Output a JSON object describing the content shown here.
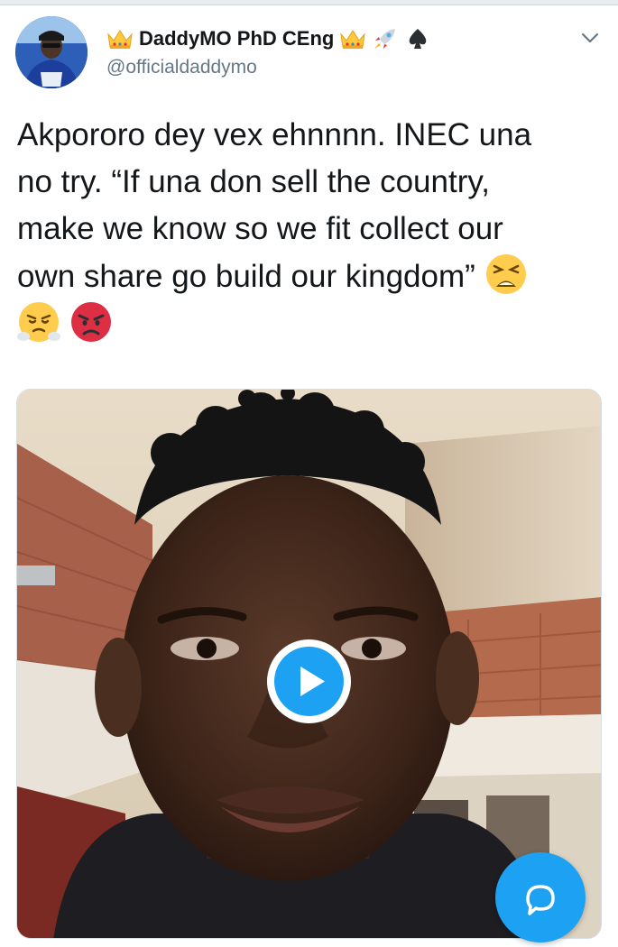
{
  "tweet": {
    "display_name": "DaddyMO PhD CEng",
    "handle": "@officialdaddymo",
    "text_lines": [
      "Akpororo dey vex ehnnnn. INEC una",
      "no try. “If una don sell the country,",
      "make we know so we fit collect our",
      "own share go build our kingdom”"
    ],
    "name_emojis": [
      "crown-emoji",
      "crown-emoji",
      "rocket-emoji",
      "spade-suit-icon"
    ],
    "text_emojis": [
      "tired-face-emoji",
      "face-with-steam-emoji",
      "angry-face-emoji"
    ]
  },
  "media": {
    "type": "video",
    "play_icon": "play-icon"
  },
  "actions": {
    "menu_icon": "chevron-down-icon",
    "fab_icon": "compose-reply-icon"
  },
  "colors": {
    "accent": "#1da1f2",
    "text": "#14171a",
    "secondary": "#657786",
    "emoji_yellow": "#ffc83d",
    "emoji_red": "#dd2e44"
  }
}
